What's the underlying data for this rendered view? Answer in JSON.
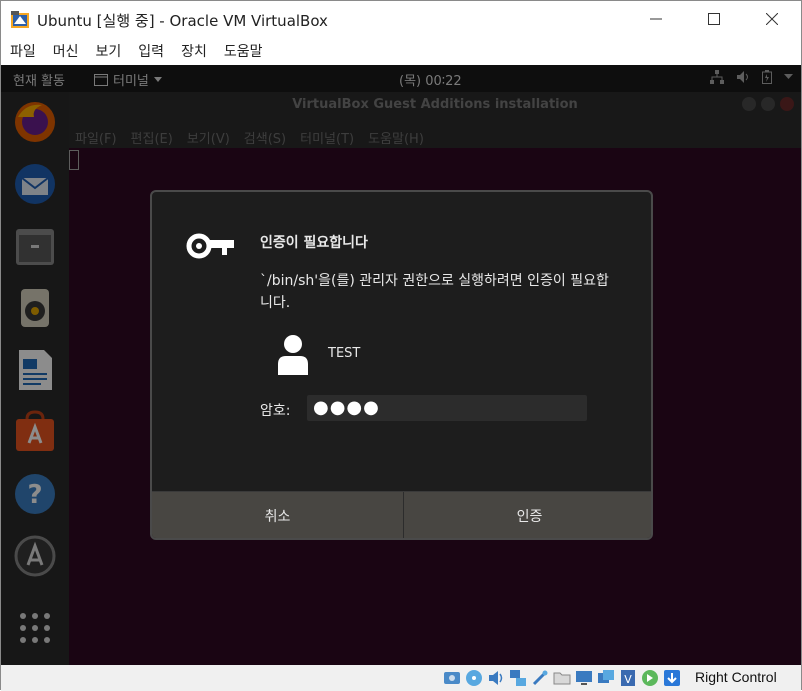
{
  "window": {
    "title": "Ubuntu [실행 중] - Oracle VM VirtualBox",
    "menu": [
      "파일",
      "머신",
      "보기",
      "입력",
      "장치",
      "도움말"
    ]
  },
  "ubuntu_topbar": {
    "activities": "현재 활동",
    "app_menu": "터미널",
    "clock": "(목) 00∶22"
  },
  "dock": {
    "items": [
      "firefox-icon",
      "thunderbird-icon",
      "files-icon",
      "rhythmbox-icon",
      "writer-icon",
      "software-icon",
      "help-icon",
      "updates-icon",
      "show-apps-icon"
    ]
  },
  "terminal": {
    "title": "VirtualBox Guest Additions installation",
    "menu": [
      "파일(F)",
      "편집(E)",
      "보기(V)",
      "검색(S)",
      "터미널(T)",
      "도움말(H)"
    ]
  },
  "auth_dialog": {
    "title": "인증이 필요합니다",
    "message": "`/bin/sh'을(를) 관리자 권한으로 실행하려면 인증이 필요합니다.",
    "user": "TEST",
    "password_label": "암호:",
    "password_mask": "●●●●",
    "cancel": "취소",
    "authenticate": "인증"
  },
  "statusbar": {
    "host_key": "Right Control"
  },
  "colors": {
    "guest_bg": "#2c0d20",
    "dialog_bg": "#1d1d1d",
    "dialog_buttons": "#484642"
  }
}
